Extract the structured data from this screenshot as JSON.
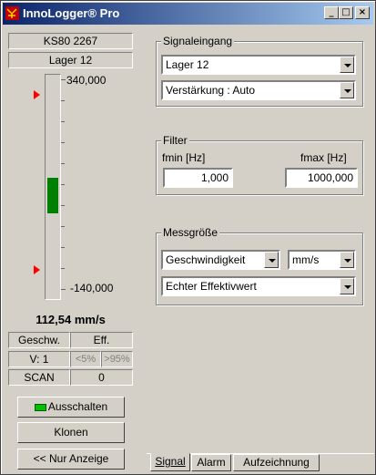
{
  "window": {
    "title": "InnoLogger® Pro",
    "minimize": "_",
    "maximize": "□",
    "close": "×"
  },
  "left": {
    "sensor": "KS80 2267",
    "location": "Lager 12",
    "scale_max": "340,000",
    "scale_min": "-140,000",
    "level_fraction": 0.17,
    "reading": "112,54 mm/s",
    "mode_label": "Geschw.",
    "mode_type": "Eff.",
    "v_label": "V: 1",
    "lt5": "<5%",
    "gt95": ">95%",
    "scan_label": "SCAN",
    "scan_value": "0",
    "btn_off": "Ausschalten",
    "btn_clone": "Klonen",
    "btn_display": "<< Nur Anzeige"
  },
  "signal": {
    "group_title": "Signaleingang",
    "input": "Lager 12",
    "gain": "Verstärkung : Auto"
  },
  "filter": {
    "group_title": "Filter",
    "fmin_label": "fmin [Hz]",
    "fmax_label": "fmax [Hz]",
    "fmin": "1,000",
    "fmax": "1000,000"
  },
  "measure": {
    "group_title": "Messgröße",
    "quantity": "Geschwindigkeit",
    "unit": "mm/s",
    "method": "Echter Effektivwert"
  },
  "tabs": [
    "Signal",
    "Alarm",
    "Aufzeichnung"
  ],
  "colors": {
    "bar": "#008000",
    "led": "#00c000",
    "marker": "#ff0000"
  }
}
